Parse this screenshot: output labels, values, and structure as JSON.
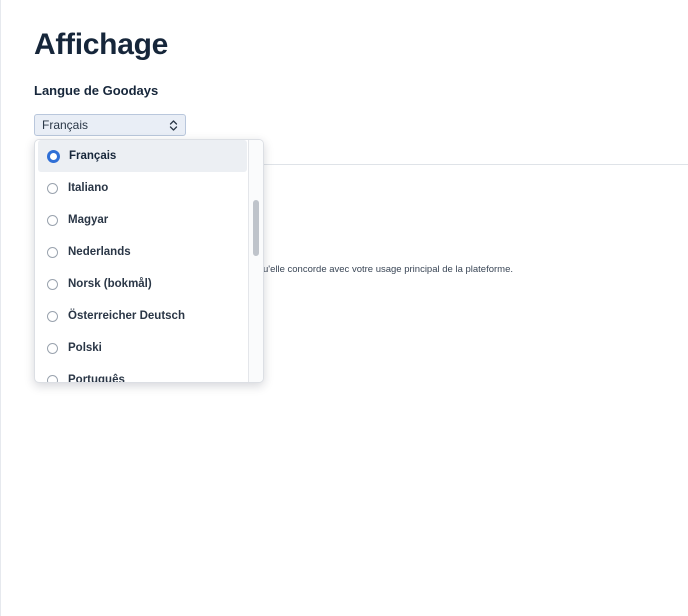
{
  "page": {
    "title": "Affichage",
    "section_label": "Langue de Goodays",
    "hint_text": "u'elle concorde avec votre usage principal de la plateforme."
  },
  "language_select": {
    "value": "Français",
    "options": [
      {
        "label": "Français",
        "selected": true
      },
      {
        "label": "Italiano",
        "selected": false
      },
      {
        "label": "Magyar",
        "selected": false
      },
      {
        "label": "Nederlands",
        "selected": false
      },
      {
        "label": "Norsk (bokmål)",
        "selected": false
      },
      {
        "label": "Österreicher Deutsch",
        "selected": false
      },
      {
        "label": "Polski",
        "selected": false
      },
      {
        "label": "Português",
        "selected": false
      }
    ]
  },
  "icons": {
    "select_chevrons": "chevron-up-down-icon",
    "radio": "radio-icon"
  },
  "colors": {
    "accent": "#2f6fd6",
    "select_bg": "#e9eef6",
    "selected_option_bg": "#eceff3",
    "title": "#16263a"
  }
}
